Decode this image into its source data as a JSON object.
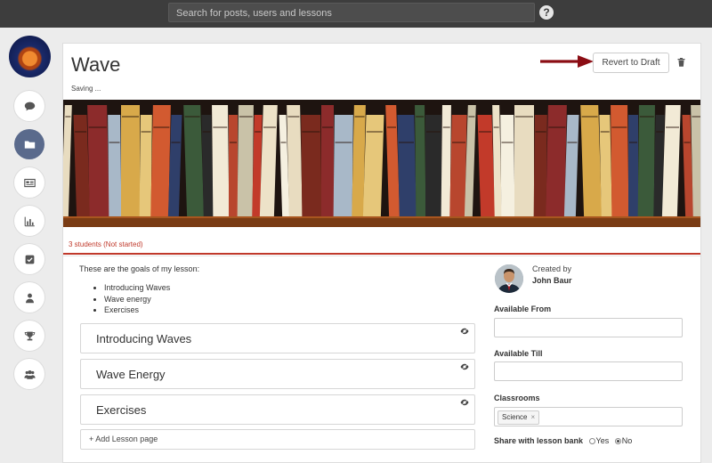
{
  "topbar": {
    "search_placeholder": "Search for posts, users and lessons",
    "help_label": "?"
  },
  "sidebar": {
    "items": [
      {
        "icon": "chat-bubble-icon",
        "active": false
      },
      {
        "icon": "folder-icon",
        "active": true
      },
      {
        "icon": "newspaper-icon",
        "active": false
      },
      {
        "icon": "bar-chart-icon",
        "active": false
      },
      {
        "icon": "checkbox-icon",
        "active": false
      },
      {
        "icon": "user-icon",
        "active": false
      },
      {
        "icon": "trophy-icon",
        "active": false
      },
      {
        "icon": "users-group-icon",
        "active": false
      }
    ]
  },
  "lesson": {
    "title": "Wave",
    "saving_status": "Saving ...",
    "revert_label": "Revert to Draft",
    "students_status": "3 students (Not started)",
    "goals_intro": "These are the goals of my lesson:",
    "goals": [
      "Introducing Waves",
      "Wave energy",
      "Exercises"
    ],
    "pages": [
      "Introducing Waves",
      "Wave Energy",
      "Exercises"
    ],
    "add_page_label": "+ Add Lesson page"
  },
  "details": {
    "created_by_label": "Created by",
    "creator_name": "John Baur",
    "available_from_label": "Available From",
    "available_from_value": "",
    "available_till_label": "Available Till",
    "available_till_value": "",
    "classrooms_label": "Classrooms",
    "classroom_tag": "Science",
    "tag_remove": "×",
    "share_label": "Share with lesson bank",
    "share_yes": "Yes",
    "share_no": "No",
    "share_selected": "No"
  },
  "colors": {
    "accent_red": "#c0392b",
    "arrow_red": "#8b0d14",
    "sidebar_active": "#5a6a8c",
    "topbar": "#3d3d3d"
  }
}
